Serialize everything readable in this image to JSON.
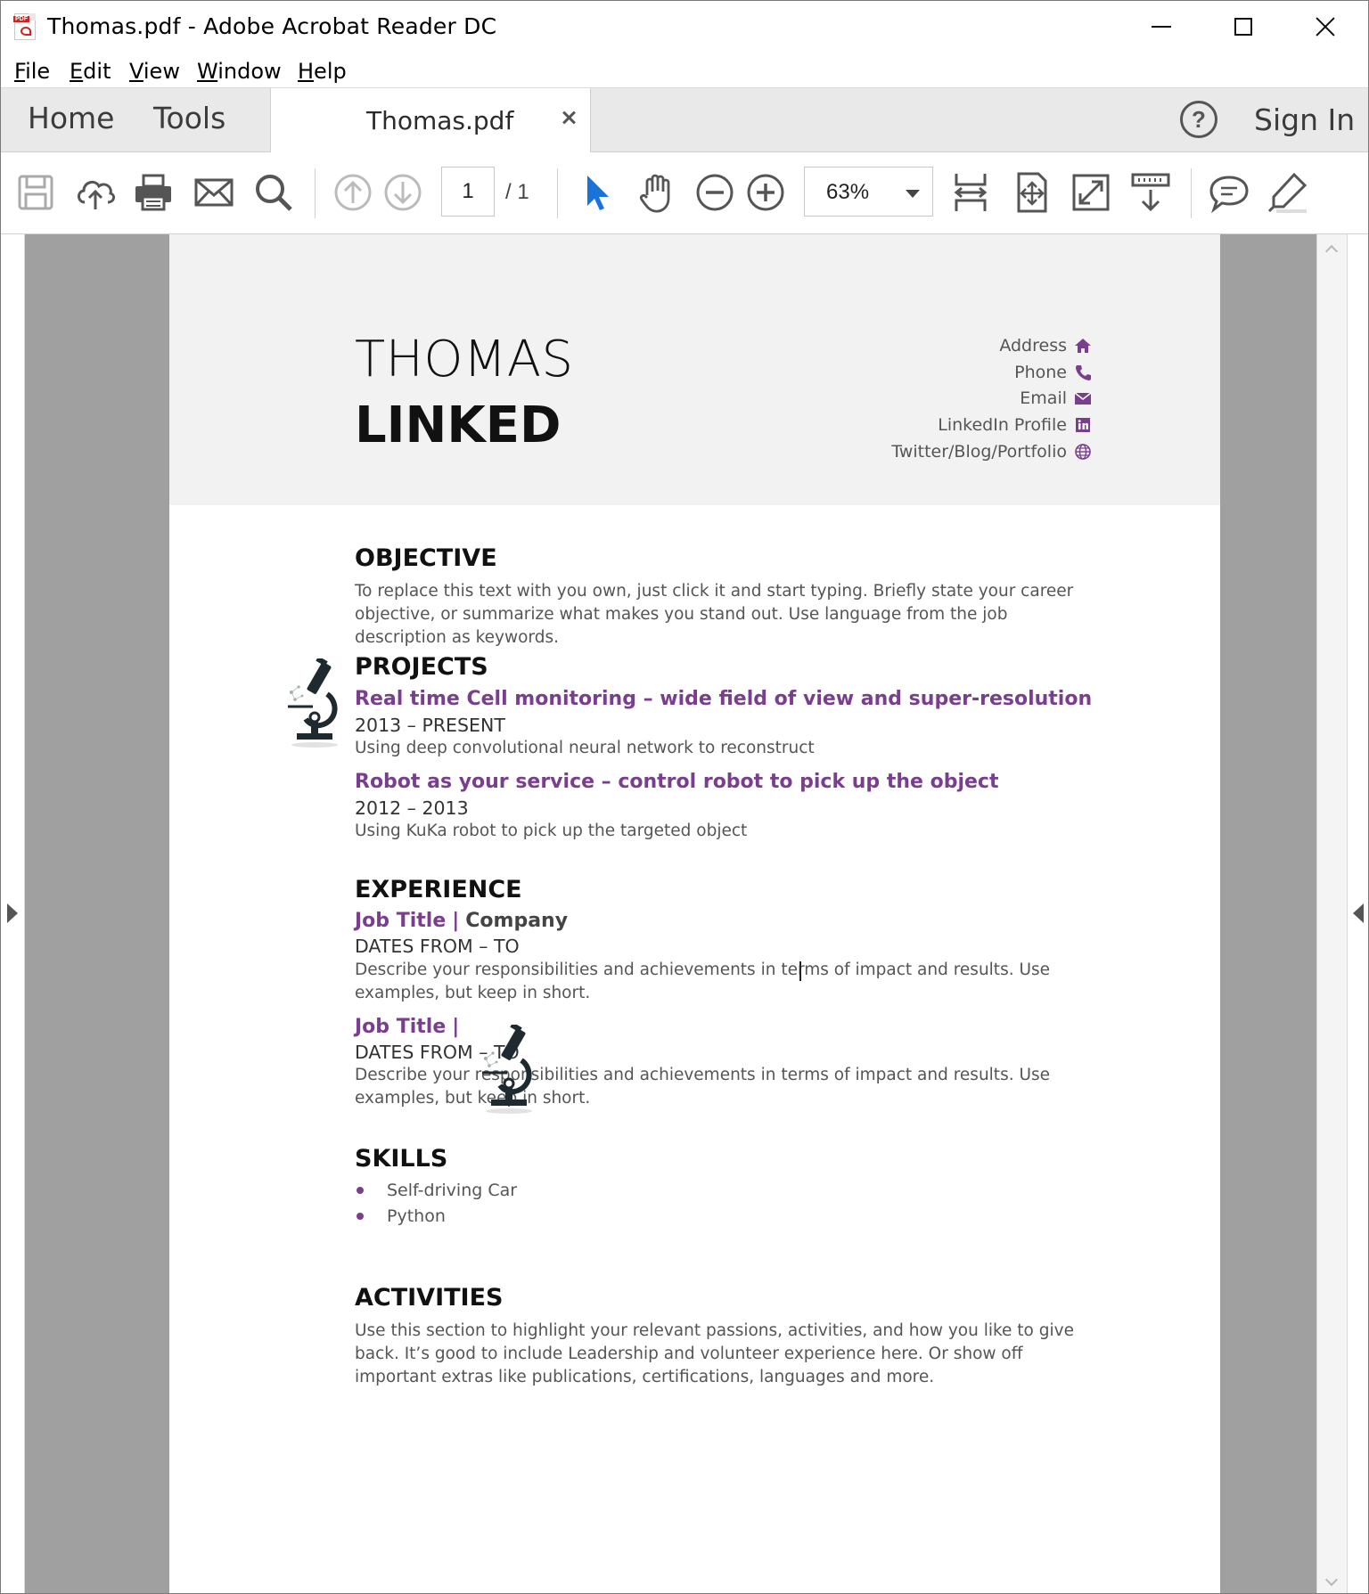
{
  "window": {
    "title": "Thomas.pdf - Adobe Acrobat Reader DC"
  },
  "menu": {
    "items": [
      "File",
      "Edit",
      "View",
      "Window",
      "Help"
    ]
  },
  "tabs": {
    "home": "Home",
    "tools": "Tools",
    "document": "Thomas.pdf",
    "sign_in": "Sign In",
    "help_glyph": "?"
  },
  "toolbar": {
    "page_current": "1",
    "page_total": "/  1",
    "zoom": "63%",
    "icons": [
      "save-icon",
      "cloud-upload-icon",
      "print-icon",
      "email-icon",
      "search-icon",
      "page-up-icon",
      "page-down-icon",
      "select-arrow-icon",
      "hand-icon",
      "zoom-out-icon",
      "zoom-in-icon",
      "fit-width-icon",
      "fit-page-icon",
      "full-screen-icon",
      "scroll-mode-icon",
      "comment-icon",
      "highlight-icon"
    ]
  },
  "accent_color": "#7a3e8f",
  "resume": {
    "first_name": "THOMAS",
    "last_name": "LINKED",
    "contacts": [
      {
        "label": "Address",
        "icon": "home-icon"
      },
      {
        "label": "Phone",
        "icon": "phone-icon"
      },
      {
        "label": "Email",
        "icon": "envelope-icon"
      },
      {
        "label": "LinkedIn Profile",
        "icon": "linkedin-icon"
      },
      {
        "label": "Twitter/Blog/Portfolio",
        "icon": "globe-icon"
      }
    ],
    "objective": {
      "heading": "OBJECTIVE",
      "text": "To replace this text with you own, just click it and start typing. Briefly state your career objective, or summarize what makes you stand out. Use language from the job description as keywords."
    },
    "projects": {
      "heading": "PROJECTS",
      "items": [
        {
          "title": "Real time Cell monitoring – wide field of view and super-resolution",
          "dates": "2013 – PRESENT",
          "desc": "Using deep convolutional neural network to reconstruct"
        },
        {
          "title": "Robot as your service – control robot to pick up the object",
          "dates": "2012 – 2013",
          "desc": "Using KuKa robot to pick up the targeted object"
        }
      ]
    },
    "experience": {
      "heading": "EXPERIENCE",
      "items": [
        {
          "title": "Job Title",
          "sep": "|",
          "company": "Company",
          "dates": "DATES FROM – TO",
          "desc": "Describe your responsibilities and achievements in terms of impact and results. Use examples, but keep in short."
        },
        {
          "title": "Job Title",
          "sep": "|",
          "company": "",
          "dates": "DATES FROM – TO",
          "desc": "Describe your responsibilities and achievements in terms of impact and results. Use examples, but keep in short."
        }
      ]
    },
    "skills": {
      "heading": "SKILLS",
      "items": [
        "Self-driving Car",
        "Python"
      ]
    },
    "activities": {
      "heading": "ACTIVITIES",
      "text": "Use this section to highlight your relevant passions, activities, and how you like to give back. It’s good to include Leadership and volunteer experience here. Or show off important extras like publications, certifications, languages and more."
    }
  }
}
